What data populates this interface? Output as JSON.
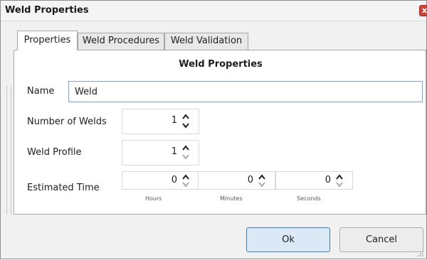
{
  "window": {
    "title": "Weld Properties",
    "close_glyph": "x"
  },
  "tabs": [
    {
      "label": "Properties",
      "active": true
    },
    {
      "label": "Weld Procedures",
      "active": false
    },
    {
      "label": "Weld Validation",
      "active": false
    }
  ],
  "panel": {
    "title": "Weld Properties",
    "name": {
      "label": "Name",
      "value": "Weld"
    },
    "number_of_welds": {
      "label": "Number of Welds",
      "value": "1"
    },
    "weld_profile": {
      "label": "Weld Profile",
      "value": "1"
    },
    "estimated_time": {
      "label": "Estimated Time",
      "hours": {
        "value": "0",
        "unit": "Hours"
      },
      "minutes": {
        "value": "0",
        "unit": "Minutes"
      },
      "seconds": {
        "value": "0",
        "unit": "Seconds"
      }
    }
  },
  "buttons": {
    "ok": "Ok",
    "cancel": "Cancel"
  },
  "colors": {
    "accent_border": "#3c7fb1",
    "ok_fill": "#dbe9f7",
    "close_red": "#c9463d"
  },
  "icons": [
    "close-icon",
    "spin-up-icon",
    "spin-down-icon",
    "resize-grip-icon"
  ]
}
